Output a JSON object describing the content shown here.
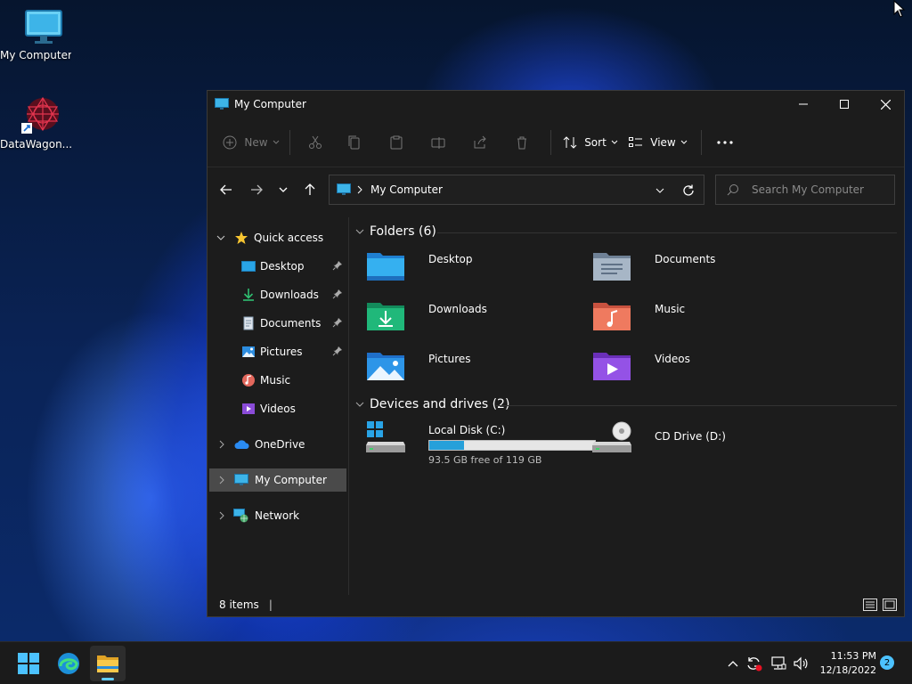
{
  "desktop": {
    "icons": [
      {
        "label": "My Computer",
        "icon": "monitor-icon"
      },
      {
        "label": "DataWagon...",
        "icon": "app-shortcut-icon"
      }
    ]
  },
  "window": {
    "title": "My Computer",
    "toolbar": {
      "new_label": "New",
      "sort_label": "Sort",
      "view_label": "View"
    },
    "address": {
      "path": "My Computer"
    },
    "search": {
      "placeholder": "Search My Computer"
    },
    "sidebar": {
      "quick_access": "Quick access",
      "items": [
        {
          "label": "Desktop",
          "pinned": true
        },
        {
          "label": "Downloads",
          "pinned": true
        },
        {
          "label": "Documents",
          "pinned": true
        },
        {
          "label": "Pictures",
          "pinned": true
        },
        {
          "label": "Music",
          "pinned": false
        },
        {
          "label": "Videos",
          "pinned": false
        }
      ],
      "onedrive": "OneDrive",
      "my_computer": "My Computer",
      "network": "Network"
    },
    "content": {
      "folders_header": "Folders (6)",
      "folders": [
        {
          "name": "Desktop"
        },
        {
          "name": "Documents"
        },
        {
          "name": "Downloads"
        },
        {
          "name": "Music"
        },
        {
          "name": "Pictures"
        },
        {
          "name": "Videos"
        }
      ],
      "drives_header": "Devices and drives (2)",
      "drives": [
        {
          "name": "Local Disk (C:)",
          "free_text": "93.5 GB free of 119 GB",
          "used_fraction": 0.21
        },
        {
          "name": "CD Drive (D:)"
        }
      ]
    },
    "status": {
      "items": "8 items"
    }
  },
  "taskbar": {
    "time": "11:53 PM",
    "date": "12/18/2022",
    "notification_count": "2"
  },
  "colors": {
    "accent": "#60cdff",
    "folder_yellow": "#f6c042",
    "drive_bar": "#26a0da"
  }
}
